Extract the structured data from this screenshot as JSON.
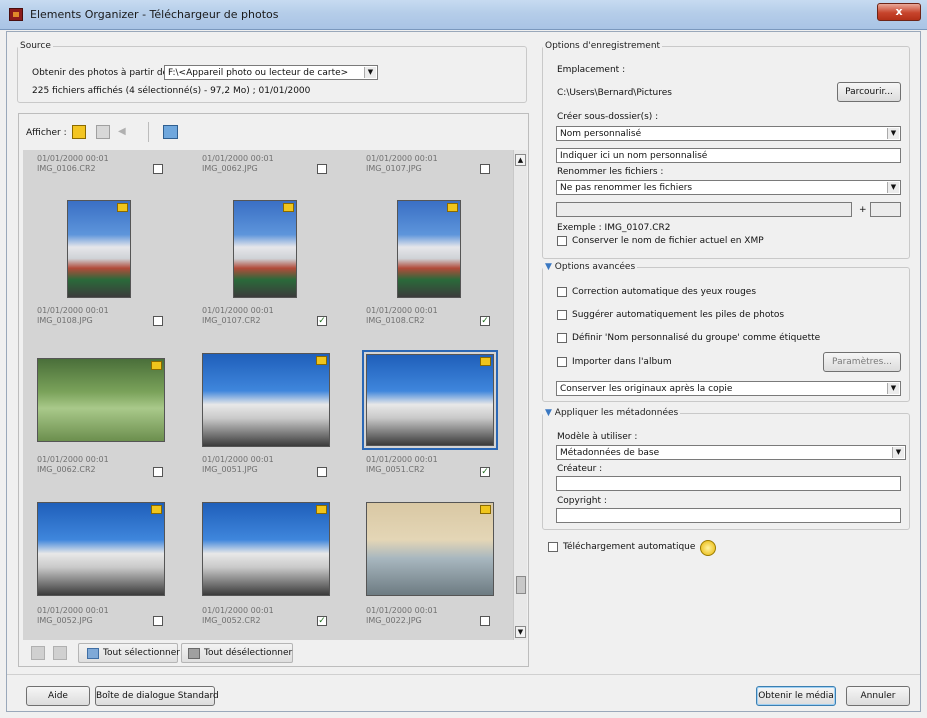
{
  "window": {
    "title": "Elements Organizer - Téléchargeur de photos",
    "close": "x"
  },
  "source": {
    "legend": "Source",
    "get_from_label": "Obtenir des photos à partir de :",
    "get_from_value": "F:\\<Appareil photo ou lecteur de carte>",
    "status": "225 fichiers affichés (4 sélectionné(s) - 97,2 Mo) ; 01/01/2000"
  },
  "toolbar": {
    "show_label": "Afficher :"
  },
  "thumbnails": [
    {
      "date": "01/01/2000 00:01",
      "name": "IMG_0106.CR2",
      "checked": false,
      "text": ""
    },
    {
      "date": "01/01/2000 00:01",
      "name": "IMG_0062.JPG",
      "checked": false,
      "text": ""
    },
    {
      "date": "01/01/2000 00:01",
      "name": "IMG_0107.JPG",
      "checked": false,
      "text": ""
    },
    {
      "date": "01/01/2000 00:01",
      "name": "IMG_0108.JPG",
      "checked": false,
      "text": ""
    },
    {
      "date": "01/01/2000 00:01",
      "name": "IMG_0107.CR2",
      "checked": true,
      "text": "✓"
    },
    {
      "date": "01/01/2000 00:01",
      "name": "IMG_0108.CR2",
      "checked": true,
      "text": "✓"
    },
    {
      "date": "01/01/2000 00:01",
      "name": "IMG_0062.CR2",
      "checked": false,
      "text": ""
    },
    {
      "date": "01/01/2000 00:01",
      "name": "IMG_0051.JPG",
      "checked": false,
      "text": ""
    },
    {
      "date": "01/01/2000 00:01",
      "name": "IMG_0051.CR2",
      "checked": true,
      "text": "✓"
    },
    {
      "date": "01/01/2000 00:01",
      "name": "IMG_0052.JPG",
      "checked": false,
      "text": ""
    },
    {
      "date": "01/01/2000 00:01",
      "name": "IMG_0052.CR2",
      "checked": true,
      "text": "✓"
    },
    {
      "date": "01/01/2000 00:01",
      "name": "IMG_0022.JPG",
      "checked": false,
      "text": ""
    }
  ],
  "bottom_toolbar": {
    "select_all": "Tout sélectionner",
    "deselect_all": "Tout désélectionner"
  },
  "save_options": {
    "legend": "Options d'enregistrement",
    "location_label": "Emplacement :",
    "location_value": "C:\\Users\\Bernard\\Pictures",
    "browse": "Parcourir...",
    "subfolder_label": "Créer sous-dossier(s) :",
    "subfolder_value": "Nom personnalisé",
    "custom_name_value": "Indiquer ici un nom personnalisé",
    "rename_label": "Renommer les fichiers :",
    "rename_value": "Ne pas renommer les fichiers",
    "plus": "+",
    "example": "Exemple : IMG_0107.CR2",
    "keep_name_label": "Conserver le nom de fichier actuel en XMP"
  },
  "advanced": {
    "legend": "Options avancées",
    "red_eye": "Correction automatique des yeux rouges",
    "stacks": "Suggérer automatiquement les piles de photos",
    "group_tag": "Définir 'Nom personnalisé du groupe' comme étiquette",
    "album": "Importer dans l'album",
    "settings": "Paramètres...",
    "originals_value": "Conserver les originaux après la copie"
  },
  "metadata": {
    "legend": "Appliquer les métadonnées",
    "template_label": "Modèle à utiliser :",
    "template_value": "Métadonnées de base",
    "creator_label": "Créateur :",
    "copyright_label": "Copyright :"
  },
  "auto_download": {
    "label": "Téléchargement automatique"
  },
  "footer": {
    "help": "Aide",
    "standard": "Boîte de dialogue Standard",
    "get_media": "Obtenir le média",
    "cancel": "Annuler"
  }
}
